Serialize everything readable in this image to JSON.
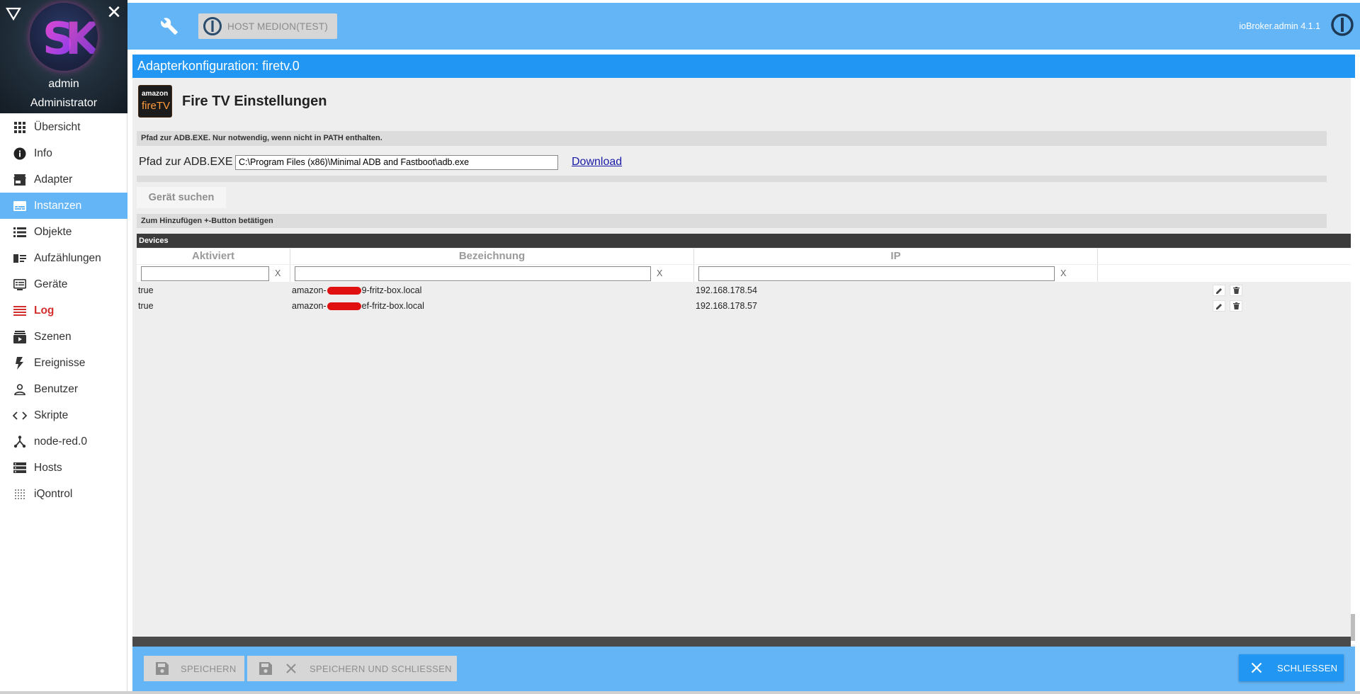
{
  "sidebar": {
    "user": "admin",
    "role": "Administrator",
    "items": [
      {
        "label": "Übersicht",
        "icon": "apps-icon"
      },
      {
        "label": "Info",
        "icon": "info-icon"
      },
      {
        "label": "Adapter",
        "icon": "store-icon"
      },
      {
        "label": "Instanzen",
        "icon": "subtitles-icon",
        "active": true
      },
      {
        "label": "Objekte",
        "icon": "list-icon"
      },
      {
        "label": "Aufzählungen",
        "icon": "enum-icon"
      },
      {
        "label": "Geräte",
        "icon": "devices-icon"
      },
      {
        "label": "Log",
        "icon": "log-icon",
        "highlight": "#d32f2f"
      },
      {
        "label": "Szenen",
        "icon": "scenes-icon"
      },
      {
        "label": "Ereignisse",
        "icon": "flash-icon"
      },
      {
        "label": "Benutzer",
        "icon": "user-icon"
      },
      {
        "label": "Skripte",
        "icon": "code-icon"
      },
      {
        "label": "node-red.0",
        "icon": "node-red-icon"
      },
      {
        "label": "Hosts",
        "icon": "storage-icon"
      },
      {
        "label": "iQontrol",
        "icon": "dots-icon"
      }
    ]
  },
  "topbar": {
    "host_label": "HOST MEDION(TEST)",
    "version": "ioBroker.admin 4.1.1",
    "accent": "#64b5f6"
  },
  "panel": {
    "title": "Adapterkonfiguration: firetv.0",
    "app_title": "Fire TV Einstellungen",
    "logo_top": "amazon",
    "logo_bottom": "fireTV",
    "title_color": "#2196f3"
  },
  "settings": {
    "adb_hint": "Pfad zur ADB.EXE. Nur notwendig, wenn nicht in PATH enthalten.",
    "adb_label": "Pfad zur ADB.EXE",
    "adb_value": "C:\\Program Files (x86)\\Minimal ADB and Fastboot\\adb.exe",
    "download_label": "Download",
    "search_button": "Gerät suchen",
    "add_hint": "Zum Hinzufügen +-Button betätigen"
  },
  "devices": {
    "title": "Devices",
    "columns": [
      "Aktiviert",
      "Bezeichnung",
      "IP"
    ],
    "filter_clear": "X",
    "rows": [
      {
        "enabled": "true",
        "name_prefix": "amazon-",
        "name_suffix": "-fritz-box.local",
        "name_suffix_visible": "9-fritz-box.local",
        "ip": "192.168.178.54"
      },
      {
        "enabled": "true",
        "name_prefix": "amazon-",
        "name_suffix": "ef-fritz-box.local",
        "name_suffix_visible": "ef-fritz-box.local",
        "ip": "192.168.178.57"
      }
    ]
  },
  "footer": {
    "save": "SPEICHERN",
    "save_close": "SPEICHERN UND SCHLIESSEN",
    "close": "SCHLIESSEN"
  }
}
